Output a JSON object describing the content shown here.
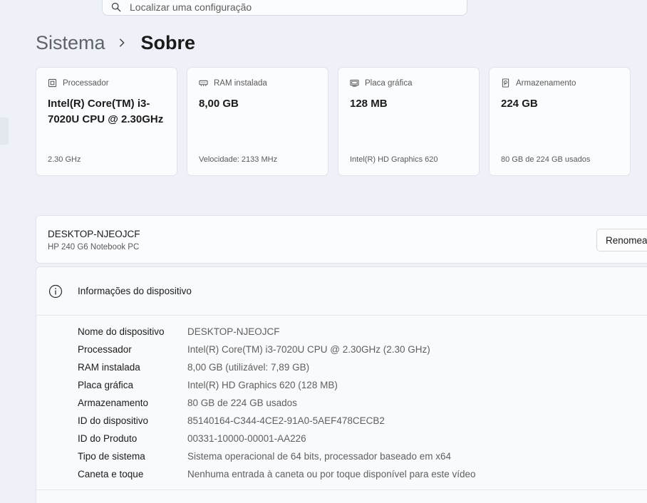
{
  "search": {
    "placeholder": "Localizar uma configuração",
    "icon": "search-icon"
  },
  "breadcrumb": {
    "parent": "Sistema",
    "current": "Sobre"
  },
  "cards": [
    {
      "label": "Processador",
      "icon": "cpu-icon",
      "value": "Intel(R) Core(TM) i3-7020U CPU @ 2.30GHz",
      "sub": "2.30 GHz"
    },
    {
      "label": "RAM instalada",
      "icon": "ram-icon",
      "value": "8,00 GB",
      "sub": "Velocidade: 2133 MHz"
    },
    {
      "label": "Placa gráfica",
      "icon": "gpu-icon",
      "value": "128 MB",
      "sub": "Intel(R) HD Graphics 620"
    },
    {
      "label": "Armazenamento",
      "icon": "storage-icon",
      "value": "224 GB",
      "sub": "80 GB de 224 GB usados"
    }
  ],
  "device": {
    "name": "DESKTOP-NJEOJCF",
    "model": "HP 240 G6 Notebook PC",
    "rename_label": "Renomear"
  },
  "info": {
    "title": "Informações do dispositivo",
    "icon": "info-icon",
    "rows": [
      {
        "key": "Nome do dispositivo",
        "value": "DESKTOP-NJEOJCF"
      },
      {
        "key": "Processador",
        "value": "Intel(R) Core(TM) i3-7020U CPU @ 2.30GHz (2.30 GHz)"
      },
      {
        "key": "RAM instalada",
        "value": "8,00 GB (utilizável: 7,89 GB)"
      },
      {
        "key": "Placa gráfica",
        "value": "Intel(R) HD Graphics 620 (128 MB)"
      },
      {
        "key": "Armazenamento",
        "value": "80 GB de 224 GB usados"
      },
      {
        "key": "ID do dispositivo",
        "value": "85140164-C344-4CE2-91A0-5AEF478CECB2"
      },
      {
        "key": "ID do Produto",
        "value": "00331-10000-00001-AA226"
      },
      {
        "key": "Tipo de sistema",
        "value": "Sistema operacional de 64 bits, processador baseado em x64"
      },
      {
        "key": "Caneta e toque",
        "value": "Nenhuma entrada à caneta ou por toque disponível para este vídeo"
      }
    ]
  },
  "colors": {
    "background": "#eef2f8",
    "card": "#fbfcfe",
    "text_primary": "#1b1b1b",
    "text_secondary": "#5f5f5f"
  }
}
